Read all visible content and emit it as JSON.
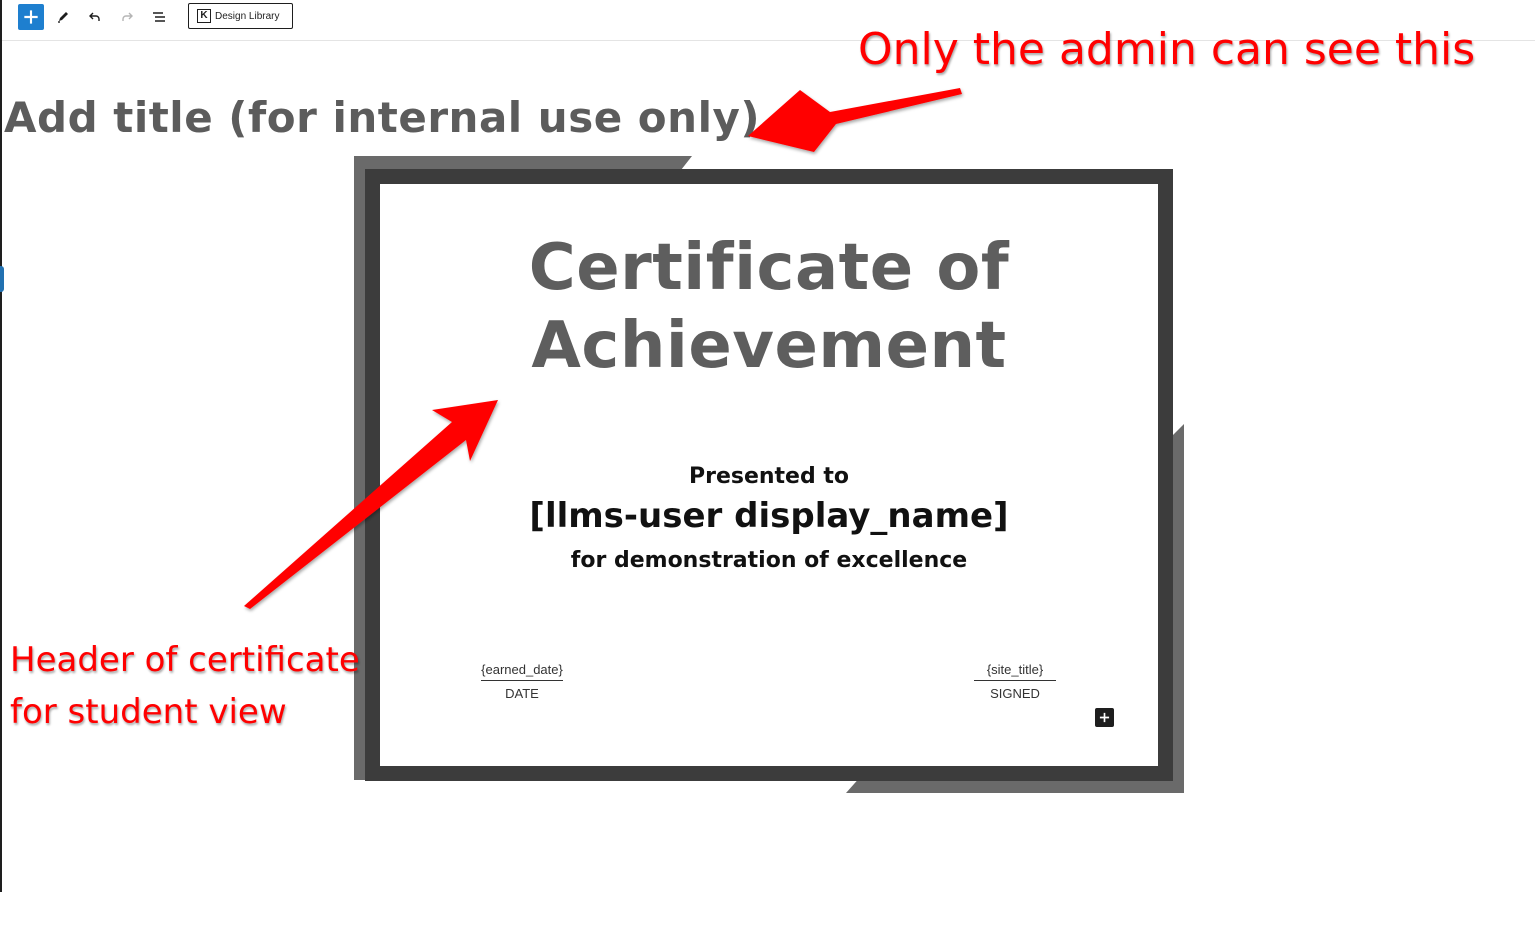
{
  "toolbar": {
    "add_icon": "plus-icon",
    "tools_icon": "pencil-icon",
    "undo_icon": "undo-icon",
    "redo_icon": "redo-icon",
    "list_view_icon": "list-view-icon",
    "design_library_label": "Design Library",
    "design_library_logo": "K",
    "accent_color": "#1e7fcf"
  },
  "editor": {
    "title_placeholder": "Add title (for internal use only)"
  },
  "annotations": {
    "admin_note": "Only the admin can see this",
    "header_note_line1": "Header of certificate",
    "header_note_line2": "for student view",
    "color": "#ff0000"
  },
  "certificate": {
    "title_line1": "Certificate of",
    "title_line2": "Achievement",
    "presented_to": "Presented to",
    "recipient": "[llms-user display_name]",
    "reason": "for demonstration of excellence",
    "date_value": "{earned_date}",
    "date_label": "DATE",
    "signed_value": "{site_title}",
    "signed_label": "SIGNED",
    "frame_color": "#3c3c3c",
    "title_color": "#5e5e5e"
  }
}
